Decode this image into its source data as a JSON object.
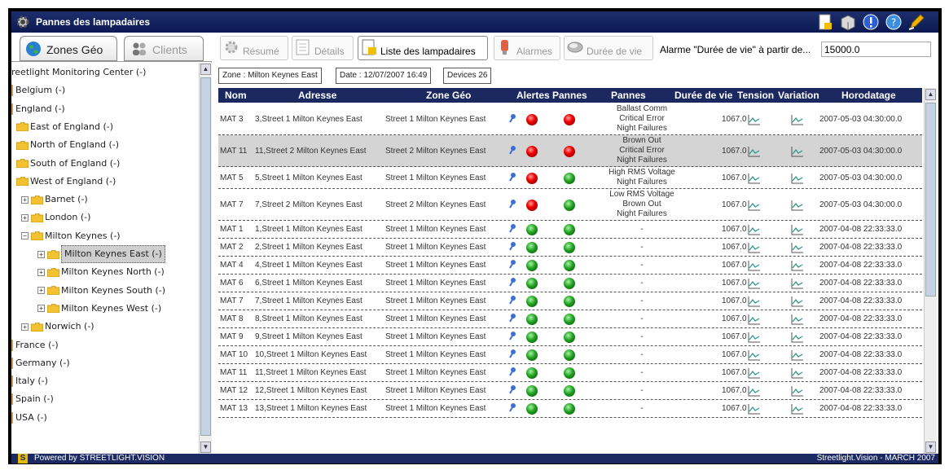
{
  "window": {
    "title": "Pannes des lampadaires"
  },
  "left_tabs": [
    {
      "label": "Zones Géo",
      "icon": "globe-icon",
      "active": true
    },
    {
      "label": "Clients",
      "icon": "users-icon",
      "active": false
    }
  ],
  "tree": [
    {
      "label": "reetlight Monitoring Center (-)",
      "level": 0,
      "type": "plain"
    },
    {
      "label": "Belgium (-)",
      "level": 0,
      "type": "bar"
    },
    {
      "label": "England (-)",
      "level": 0,
      "type": "bar"
    },
    {
      "label": "East of England (-)",
      "level": 1,
      "type": "folder"
    },
    {
      "label": "North of England (-)",
      "level": 1,
      "type": "folder"
    },
    {
      "label": "South of England (-)",
      "level": 1,
      "type": "folder"
    },
    {
      "label": "West of England (-)",
      "level": 1,
      "type": "folder"
    },
    {
      "label": "Barnet (-)",
      "level": 2,
      "type": "folder",
      "expander": "+"
    },
    {
      "label": "London (-)",
      "level": 2,
      "type": "folder",
      "expander": "+"
    },
    {
      "label": "Milton Keynes (-)",
      "level": 2,
      "type": "folder",
      "expander": "−"
    },
    {
      "label": "Milton Keynes East (-)",
      "level": 3,
      "type": "folder",
      "expander": "+",
      "selected": true
    },
    {
      "label": "Milton Keynes North (-)",
      "level": 3,
      "type": "folder",
      "expander": "+"
    },
    {
      "label": "Milton Keynes South (-)",
      "level": 3,
      "type": "folder",
      "expander": "+"
    },
    {
      "label": "Milton Keynes West (-)",
      "level": 3,
      "type": "folder",
      "expander": "+"
    },
    {
      "label": "Norwich (-)",
      "level": 2,
      "type": "folder",
      "expander": "+"
    },
    {
      "label": "France (-)",
      "level": 0,
      "type": "bar"
    },
    {
      "label": "Germany (-)",
      "level": 0,
      "type": "bar"
    },
    {
      "label": "Italy (-)",
      "level": 0,
      "type": "bar"
    },
    {
      "label": "Spain (-)",
      "level": 0,
      "type": "bar"
    },
    {
      "label": "USA (-)",
      "level": 0,
      "type": "bar"
    }
  ],
  "toolbar": {
    "resume": "Résumé",
    "details": "Détails",
    "liste": "Liste des lampadaires",
    "alarmes": "Alarmes",
    "duree": "Durée de vie",
    "alarm_label": "Alarme \"Durée de vie\" à partir de...",
    "alarm_value": "15000.0"
  },
  "info": {
    "zone": "Zone : Milton Keynes East",
    "date": "Date : 12/07/2007 16:49",
    "devices": "Devices 26"
  },
  "columns": [
    "Nom",
    "Adresse",
    "Zone Géo",
    "Alertes",
    "Pannes",
    "Pannes",
    "Durée de vie",
    "Tension",
    "Variation",
    "Horodatage"
  ],
  "rows": [
    {
      "nom": "MAT 3",
      "adresse": "3,Street 1 Milton Keynes East",
      "zone": "Street 1 Milton Keynes East",
      "alerte": "red",
      "panne": "red",
      "pannes": [
        "Ballast Comm",
        "Critical Error",
        "Night Failures"
      ],
      "duree": "1067.0",
      "horodatage": "2007-05-03 04:30:00.0"
    },
    {
      "nom": "MAT 11",
      "adresse": "11,Street 2 Milton Keynes East",
      "zone": "Street 2 Milton Keynes East",
      "alerte": "red",
      "panne": "red",
      "pannes": [
        "Brown Out",
        "Critical Error",
        "Night Failures"
      ],
      "duree": "1067.0",
      "horodatage": "2007-05-03 04:30:00.0",
      "highlight": true
    },
    {
      "nom": "MAT 5",
      "adresse": "5,Street 1 Milton Keynes East",
      "zone": "Street 1 Milton Keynes East",
      "alerte": "red",
      "panne": "green",
      "pannes": [
        "High RMS Voltage",
        "Night Failures"
      ],
      "duree": "1067.0",
      "horodatage": "2007-05-03 04:30:00.0"
    },
    {
      "nom": "MAT 7",
      "adresse": "7,Street 2 Milton Keynes East",
      "zone": "Street 2 Milton Keynes East",
      "alerte": "red",
      "panne": "green",
      "pannes": [
        "Low RMS Voltage",
        "Brown Out",
        "Night Failures"
      ],
      "duree": "1067.0",
      "horodatage": "2007-05-03 04:30:00.0"
    },
    {
      "nom": "MAT 1",
      "adresse": "1,Street 1 Milton Keynes East",
      "zone": "Street 1 Milton Keynes East",
      "alerte": "green",
      "panne": "green",
      "pannes": [
        "-"
      ],
      "duree": "1067.0",
      "horodatage": "2007-04-08 22:33:33.0"
    },
    {
      "nom": "MAT 2",
      "adresse": "2,Street 1 Milton Keynes East",
      "zone": "Street 1 Milton Keynes East",
      "alerte": "green",
      "panne": "green",
      "pannes": [
        "-"
      ],
      "duree": "1067.0",
      "horodatage": "2007-04-08 22:33:33.0"
    },
    {
      "nom": "MAT 4",
      "adresse": "4,Street 1 Milton Keynes East",
      "zone": "Street 1 Milton Keynes East",
      "alerte": "green",
      "panne": "green",
      "pannes": [
        "-"
      ],
      "duree": "1067.0",
      "horodatage": "2007-04-08 22:33:33.0"
    },
    {
      "nom": "MAT 6",
      "adresse": "6,Street 1 Milton Keynes East",
      "zone": "Street 1 Milton Keynes East",
      "alerte": "green",
      "panne": "green",
      "pannes": [
        "-"
      ],
      "duree": "1067.0",
      "horodatage": "2007-04-08 22:33:33.0"
    },
    {
      "nom": "MAT 7",
      "adresse": "7,Street 1 Milton Keynes East",
      "zone": "Street 1 Milton Keynes East",
      "alerte": "green",
      "panne": "green",
      "pannes": [
        "-"
      ],
      "duree": "1067.0",
      "horodatage": "2007-04-08 22:33:33.0"
    },
    {
      "nom": "MAT 8",
      "adresse": "8,Street 1 Milton Keynes East",
      "zone": "Street 1 Milton Keynes East",
      "alerte": "green",
      "panne": "green",
      "pannes": [
        "-"
      ],
      "duree": "1067.0",
      "horodatage": "2007-04-08 22:33:33.0"
    },
    {
      "nom": "MAT 9",
      "adresse": "9,Street 1 Milton Keynes East",
      "zone": "Street 1 Milton Keynes East",
      "alerte": "green",
      "panne": "green",
      "pannes": [
        "-"
      ],
      "duree": "1067.0",
      "horodatage": "2007-04-08 22:33:33.0"
    },
    {
      "nom": "MAT 10",
      "adresse": "10,Street 1 Milton Keynes East",
      "zone": "Street 1 Milton Keynes East",
      "alerte": "green",
      "panne": "green",
      "pannes": [
        "-"
      ],
      "duree": "1067.0",
      "horodatage": "2007-04-08 22:33:33.0"
    },
    {
      "nom": "MAT 11",
      "adresse": "11,Street 1 Milton Keynes East",
      "zone": "Street 1 Milton Keynes East",
      "alerte": "green",
      "panne": "green",
      "pannes": [
        "-"
      ],
      "duree": "1067.0",
      "horodatage": "2007-04-08 22:33:33.0"
    },
    {
      "nom": "MAT 12",
      "adresse": "12,Street 1 Milton Keynes East",
      "zone": "Street 1 Milton Keynes East",
      "alerte": "green",
      "panne": "green",
      "pannes": [
        "-"
      ],
      "duree": "1067.0",
      "horodatage": "2007-04-08 22:33:33.0"
    },
    {
      "nom": "MAT 13",
      "adresse": "13,Street 1 Milton Keynes East",
      "zone": "Street 1 Milton Keynes East",
      "alerte": "green",
      "panne": "green",
      "pannes": [
        "-"
      ],
      "duree": "1067.0",
      "horodatage": "2007-04-08 22:33:33.0"
    }
  ],
  "footer": {
    "logo": "S",
    "powered": "Powered by STREETLIGHT.VISION",
    "version": "Streetlight.Vision - MARCH 2007"
  },
  "colors": {
    "header_bg": "#1c2960",
    "titlebar_bg": "#0b1a52",
    "alert_red": "#e00000",
    "ok_green": "#1fa21f",
    "selected_row": "#d4d4d4"
  }
}
